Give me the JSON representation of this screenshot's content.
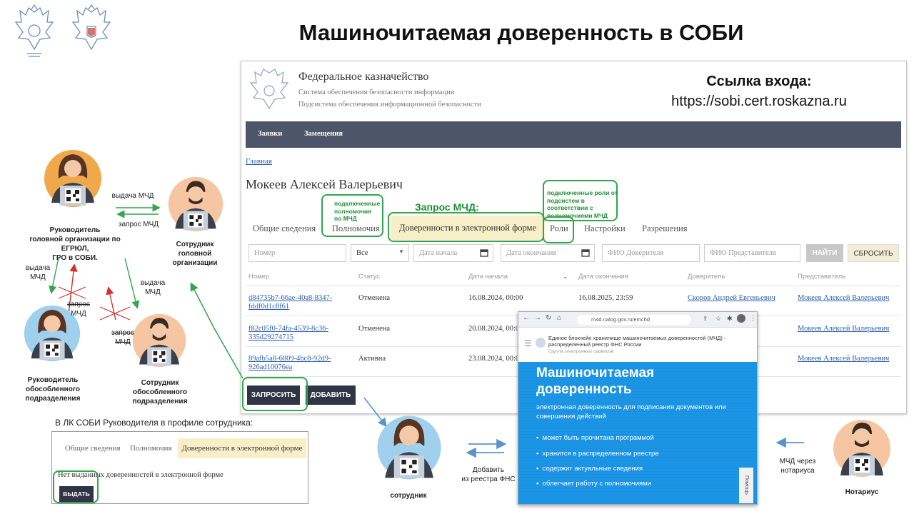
{
  "slide": {
    "title": "Машиночитаемая доверенность в СОБИ"
  },
  "portal": {
    "org_name": "Федеральное казначейство",
    "subtitle1": "Система обеспечения безопасности информации",
    "subtitle2": "Подсистема обеспечения информационной безопасности",
    "login_title": "Ссылка входа:",
    "login_url": "https://sobi.cert.roskazna.ru",
    "nav": [
      "Заявки",
      "Замещения"
    ],
    "breadcrumb": "Главная",
    "person_name": "Мокеев Алексей Валерьевич",
    "tabs": [
      "Общие сведения",
      "Полномочия",
      "Доверенности в электронной форме",
      "Роли",
      "Настройки",
      "Разрешения"
    ],
    "filters": {
      "number": "Номер",
      "status": "Все",
      "date_start": "Дата начала",
      "date_end": "Дата окончания",
      "principal": "ФИО Доверителя",
      "representative": "ФИО Представителя",
      "find": "НАЙТИ",
      "reset": "СБРОСИТЬ"
    },
    "columns": [
      "Номер",
      "Статус",
      "Дата начала",
      "Дата окончания",
      "Доверитель",
      "Представитель"
    ],
    "rows": [
      {
        "num1": "d84735b7-66ae-40a8-8347-",
        "num2": "fddf0d1c8f61",
        "status": "Отменена",
        "start": "16.08.2024, 00:00",
        "end": "16.08.2025, 23:59",
        "principal": "Скоров Андрей Евгеньевич",
        "rep": "Мокеев Алексей Валерьевич"
      },
      {
        "num1": "f82c05f0-74fa-4539-8c36-",
        "num2": "335d29274715",
        "status": "Отменена",
        "start": "20.08.2024, 00:0",
        "end": "",
        "principal": "",
        "rep": "Мокеев Алексей Валерьевич"
      },
      {
        "num1": "89afb5a8-6809-4bc8-92d9-",
        "num2": "926ad10076ea",
        "status": "Активна",
        "start": "23.08.2024, 00:0",
        "end": "",
        "principal": "",
        "rep": "Мокеев Алексей Валерьевич"
      }
    ],
    "btn_request": "ЗАПРОСИТЬ",
    "btn_add": "ДОБАВИТЬ"
  },
  "annotations": {
    "powers_note": [
      "подключенные",
      "полномочия",
      "по МЧД"
    ],
    "request_label": "Запрос МЧД:",
    "roles_note": [
      "подключенные роли от",
      "подсистем в",
      "соответствии с",
      "полномочиями МЧД"
    ]
  },
  "people": {
    "head_org": [
      "Руководитель",
      "головной организации по ЕГРЮЛ,",
      "ГРО в СОБИ."
    ],
    "employee_head": [
      "Сотрудник",
      "головной",
      "организации"
    ],
    "head_branch": [
      "Руководитель",
      "обособленного",
      "подразделения"
    ],
    "employee_branch": [
      "Сотрудник",
      "обособленного",
      "подразделения"
    ],
    "employee": "сотрудник",
    "notary": "Нотариус"
  },
  "arrows": {
    "issue_mchd": "выдача МЧД",
    "request_mchd": "запрос МЧД",
    "issue_left": [
      "выдача",
      "МЧД"
    ],
    "request_cross1": [
      "запрос",
      "МЧД"
    ],
    "issue_right": [
      "выдача",
      "МЧД"
    ],
    "request_cross2": [
      "запрос",
      "МЧД"
    ],
    "add_fns": [
      "Добавить",
      "из реестра ФНС"
    ],
    "notary_mchd": [
      "МЧД через",
      "нотариуса"
    ]
  },
  "employee_lk": {
    "caption": "В ЛК СОБИ Руководителя в профиле сотрудника:",
    "tabs": [
      "Общие сведения",
      "Полномочия",
      "Доверенности в электронной форме"
    ],
    "empty": "Нет выданных доверенностей в электронной форме",
    "issue_button": "ВЫДАТЬ"
  },
  "m4d": {
    "url": "m4d.nalog.gov.ru/emchd",
    "header": "Единое блокчейн хранилище машиночитаемых доверенностей (МЧД) - распределенный реестр ФНС России",
    "header_sub": "Группа электронных сервисов",
    "title1": "Машиночитаемая",
    "title2": "доверенность",
    "desc": "электронная доверенность для подписания документов или совершения действий",
    "bullets": [
      "может быть прочитана программой",
      "хранится в распределенном реестре",
      "содержит актуальные сведения",
      "облегчает работу с полномочиями"
    ],
    "help": "Помощь"
  },
  "colors": {
    "highlight": "#2ea84a",
    "navbar": "#4d5568",
    "active_tab": "#f8efc8",
    "link": "#2a5db0",
    "m4d_blue": "#1b95e5",
    "arrow_blue": "#5a95c9"
  }
}
